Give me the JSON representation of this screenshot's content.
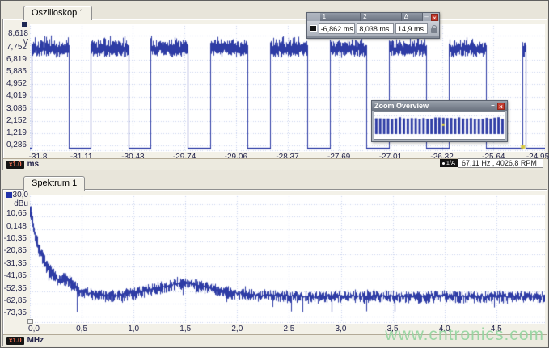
{
  "colors": {
    "trace": "#2e3ca5",
    "grid": "#c9d3ee",
    "tick_text": "#26264c",
    "scope_swatch": "#1c2752",
    "spectrum_swatch": "#2233aa",
    "cursor_yellow": "#d8c83c",
    "badge_bg": "#141414",
    "badge_text": "#ff7a5a"
  },
  "oscilloscope": {
    "tab": "Oszilloskop 1",
    "top_value": "8,618",
    "unit": "V",
    "y_ticks": [
      "7,752",
      "6,819",
      "5,885",
      "4,952",
      "4,019",
      "3,086",
      "2,152",
      "1,219",
      "0,286"
    ],
    "x_ticks": [
      "-31,8",
      "-31,11",
      "-30,43",
      "-29,74",
      "-29,06",
      "-28,37",
      "-27,69",
      "-27,01",
      "-26,32",
      "-25,64",
      "-24,95"
    ],
    "scale_badge": "x1.0",
    "x_unit": "ms",
    "status_badge": "1/A",
    "status_text": "67,11 Hz , 4026,8 RPM"
  },
  "spectrum": {
    "tab": "Spektrum 1",
    "top_value": "30,0",
    "unit": "dBu",
    "y_ticks": [
      "10,65",
      "0,148",
      "-10,35",
      "-20,85",
      "-31,35",
      "-41,85",
      "-52,35",
      "-62,85",
      "-73,35"
    ],
    "x_ticks": [
      "0,0",
      "0,5",
      "1,0",
      "1,5",
      "2,0",
      "2,5",
      "3,0",
      "3,5",
      "4,0",
      "4,5"
    ],
    "scale_badge": "x1.0",
    "x_unit": "MHz"
  },
  "measure_toolbar": {
    "columns": [
      {
        "label": "1",
        "value": "-6,862 ms"
      },
      {
        "label": "2",
        "value": "8,038 ms"
      },
      {
        "label": "Δ",
        "value": "14,9 ms"
      }
    ],
    "minimize": "–",
    "close": "×"
  },
  "zoom_overview": {
    "title": "Zoom Overview",
    "minimize": "–",
    "close": "×",
    "bars": 33
  },
  "watermark": "www.cntronics.com",
  "chart_data": [
    {
      "type": "line",
      "title": "Oszilloskop 1",
      "ylabel": "V",
      "xlabel": "ms",
      "ylim": [
        -0.647,
        8.685
      ],
      "x_range_ms": [
        -31.8,
        -24.95
      ],
      "y_tick_vals": [
        7.752,
        6.819,
        5.885,
        4.952,
        4.019,
        3.086,
        2.152,
        1.219,
        0.286
      ],
      "x_tick_vals": [
        -31.8,
        -31.11,
        -30.43,
        -29.74,
        -29.06,
        -28.37,
        -27.69,
        -27.01,
        -26.32,
        -25.64,
        -24.95
      ],
      "grid": true,
      "signal": {
        "shape": "pulse-train",
        "high_v": 7.75,
        "low_v": 0.1,
        "noise_v": 0.45,
        "pulses": [
          [
            0.002,
            0.075
          ],
          [
            0.117,
            0.19
          ],
          [
            0.233,
            0.306
          ],
          [
            0.35,
            0.422
          ],
          [
            0.465,
            0.538
          ],
          [
            0.581,
            0.653
          ],
          [
            0.697,
            0.769
          ],
          [
            0.812,
            0.884
          ],
          [
            0.955,
            0.962
          ]
        ]
      },
      "cursor": {
        "x_frac": 0.9565
      }
    },
    {
      "type": "line",
      "title": "Spektrum 1",
      "ylabel": "dBu",
      "xlabel": "MHz",
      "ylim": [
        -83.85,
        21.15
      ],
      "xlim": [
        0,
        4.97
      ],
      "y_tick_vals": [
        10.65,
        0.148,
        -10.35,
        -20.85,
        -31.35,
        -41.85,
        -52.35,
        -62.85,
        -73.35
      ],
      "x_tick_vals": [
        0,
        0.5,
        1,
        1.5,
        2,
        2.5,
        3,
        3.5,
        4,
        4.5
      ],
      "grid": true,
      "envelope_mhz_dbu": [
        [
          0,
          17
        ],
        [
          0.01,
          10
        ],
        [
          0.03,
          0
        ],
        [
          0.05,
          -8
        ],
        [
          0.08,
          -17
        ],
        [
          0.12,
          -26
        ],
        [
          0.16,
          -33
        ],
        [
          0.2,
          -38
        ],
        [
          0.25,
          -43
        ],
        [
          0.3,
          -46
        ],
        [
          0.33,
          -43
        ],
        [
          0.38,
          -46
        ],
        [
          0.45,
          -52
        ],
        [
          0.5,
          -55
        ],
        [
          0.6,
          -57
        ],
        [
          0.7,
          -58
        ],
        [
          0.8,
          -58
        ],
        [
          0.9,
          -57
        ],
        [
          1.0,
          -56
        ],
        [
          1.1,
          -54
        ],
        [
          1.2,
          -52
        ],
        [
          1.3,
          -50
        ],
        [
          1.45,
          -48
        ],
        [
          1.55,
          -48
        ],
        [
          1.7,
          -51
        ],
        [
          1.85,
          -54
        ],
        [
          2.0,
          -56
        ],
        [
          2.2,
          -58
        ],
        [
          2.4,
          -58
        ],
        [
          2.6,
          -59
        ],
        [
          2.8,
          -59
        ],
        [
          3.0,
          -58
        ],
        [
          3.2,
          -59
        ],
        [
          3.4,
          -58
        ],
        [
          3.6,
          -59
        ],
        [
          3.8,
          -59
        ],
        [
          4.0,
          -58
        ],
        [
          4.2,
          -59
        ],
        [
          4.4,
          -59
        ],
        [
          4.6,
          -59
        ],
        [
          4.97,
          -59
        ]
      ],
      "noise_db": 6,
      "down_spikes": [
        [
          0.45,
          -72
        ]
      ]
    }
  ]
}
